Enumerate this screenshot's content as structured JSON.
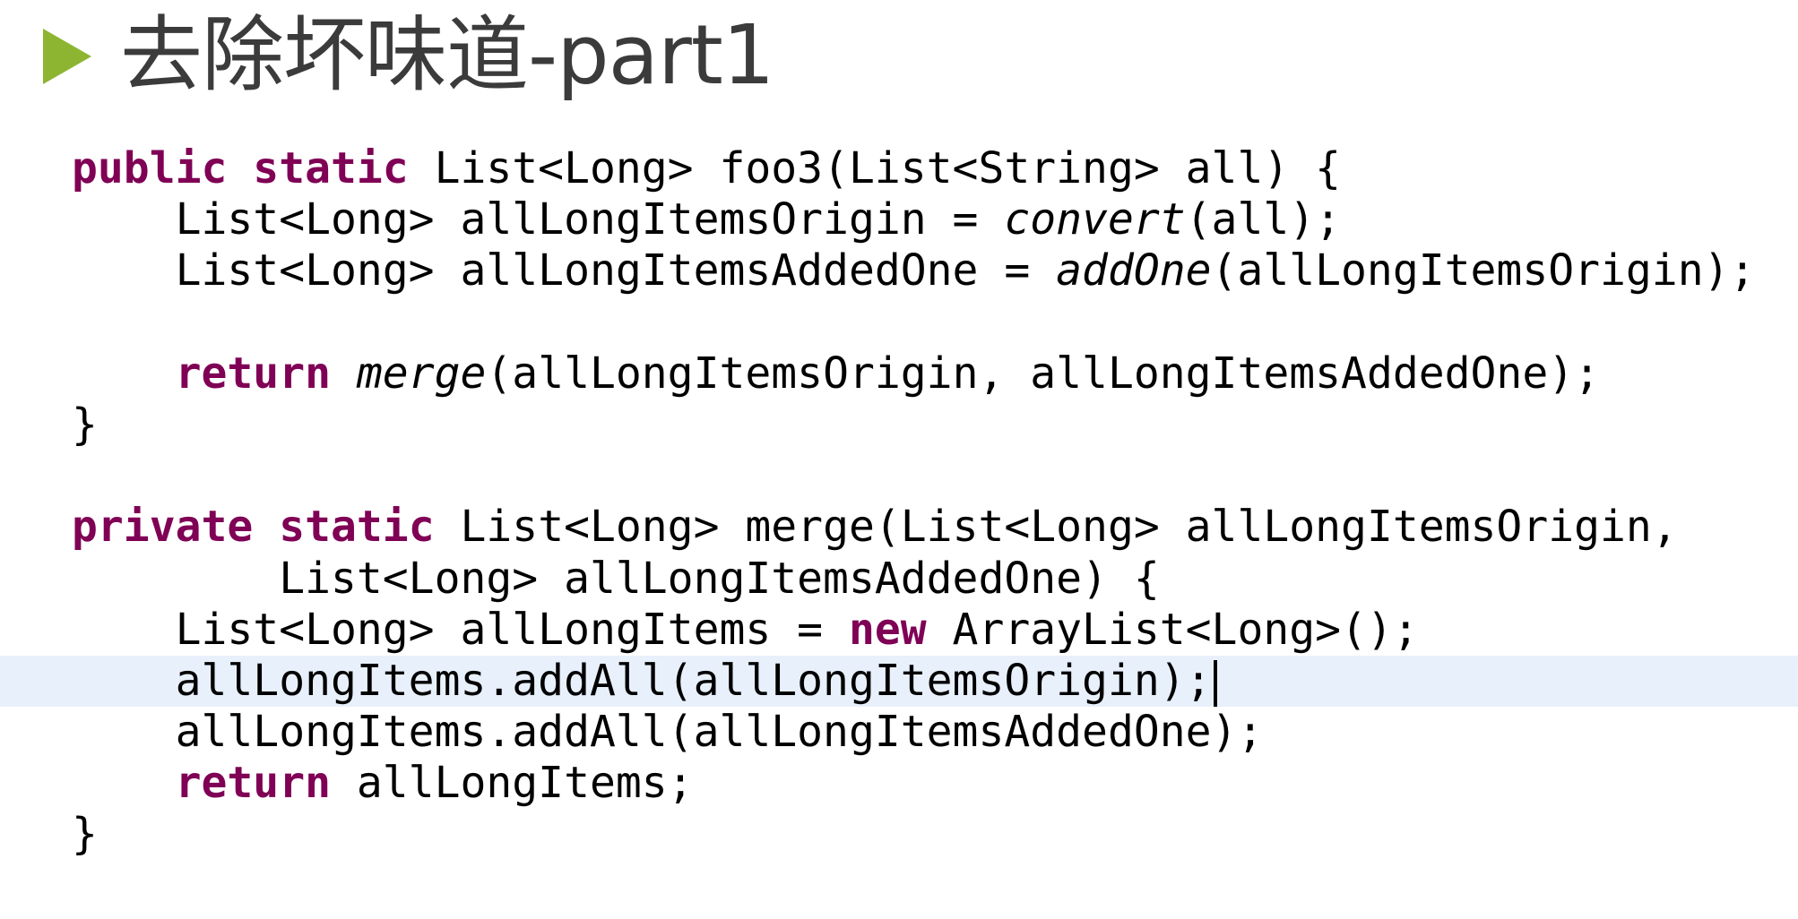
{
  "slide": {
    "title": "去除坏味道-part1",
    "bullet_color": "#8db531"
  },
  "code": {
    "keyword_color": "#7f0055",
    "highlight_color": "#e8f0fb",
    "lines": [
      {
        "indent": "",
        "segments": [
          {
            "t": "public",
            "k": "kw"
          },
          {
            "t": " ",
            "k": ""
          },
          {
            "t": "static",
            "k": "kw"
          },
          {
            "t": " List<Long> foo3(List<String> all) {",
            "k": ""
          }
        ]
      },
      {
        "indent": "    ",
        "segments": [
          {
            "t": "List<Long> allLongItemsOrigin = ",
            "k": ""
          },
          {
            "t": "convert",
            "k": "it"
          },
          {
            "t": "(all);",
            "k": ""
          }
        ]
      },
      {
        "indent": "    ",
        "segments": [
          {
            "t": "List<Long> allLongItemsAddedOne = ",
            "k": ""
          },
          {
            "t": "addOne",
            "k": "it"
          },
          {
            "t": "(allLongItemsOrigin);",
            "k": ""
          }
        ]
      },
      {
        "indent": "",
        "segments": []
      },
      {
        "indent": "    ",
        "segments": [
          {
            "t": "return",
            "k": "kw"
          },
          {
            "t": " ",
            "k": ""
          },
          {
            "t": "merge",
            "k": "it"
          },
          {
            "t": "(allLongItemsOrigin, allLongItemsAddedOne);",
            "k": ""
          }
        ]
      },
      {
        "indent": "",
        "segments": [
          {
            "t": "}",
            "k": ""
          }
        ]
      },
      {
        "indent": "",
        "segments": []
      },
      {
        "indent": "",
        "segments": [
          {
            "t": "private",
            "k": "kw"
          },
          {
            "t": " ",
            "k": ""
          },
          {
            "t": "static",
            "k": "kw"
          },
          {
            "t": " List<Long> merge(List<Long> allLongItemsOrigin,",
            "k": ""
          }
        ]
      },
      {
        "indent": "        ",
        "segments": [
          {
            "t": "List<Long> allLongItemsAddedOne) {",
            "k": ""
          }
        ]
      },
      {
        "indent": "    ",
        "segments": [
          {
            "t": "List<Long> allLongItems = ",
            "k": ""
          },
          {
            "t": "new",
            "k": "kw"
          },
          {
            "t": " ArrayList<Long>();",
            "k": ""
          }
        ]
      },
      {
        "indent": "    ",
        "highlight": true,
        "caret": true,
        "segments": [
          {
            "t": "allLongItems.addAll(allLongItemsOrigin);",
            "k": ""
          }
        ]
      },
      {
        "indent": "    ",
        "segments": [
          {
            "t": "allLongItems.addAll(allLongItemsAddedOne);",
            "k": ""
          }
        ]
      },
      {
        "indent": "    ",
        "segments": [
          {
            "t": "return",
            "k": "kw"
          },
          {
            "t": " allLongItems;",
            "k": ""
          }
        ]
      },
      {
        "indent": "",
        "segments": [
          {
            "t": "}",
            "k": ""
          }
        ]
      }
    ]
  }
}
